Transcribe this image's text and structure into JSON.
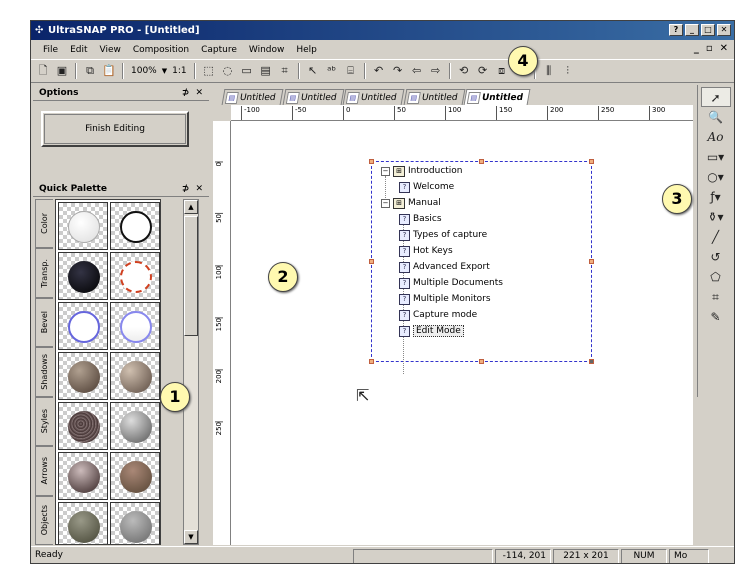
{
  "window": {
    "title": "UltraSNAP PRO - [Untitled]"
  },
  "menubar": {
    "items": [
      "File",
      "Edit",
      "View",
      "Composition",
      "Capture",
      "Window",
      "Help"
    ]
  },
  "toolbar": {
    "zoom": "100%",
    "ratio": "1:1"
  },
  "options_panel": {
    "title": "Options",
    "finish_button": "Finish Editing"
  },
  "quick_palette": {
    "title": "Quick Palette",
    "tabs": [
      "Color",
      "Transp.",
      "Bevel",
      "Shadows",
      "Styles",
      "Arrows",
      "Objects"
    ]
  },
  "doc_tabs": [
    "Untitled",
    "Untitled",
    "Untitled",
    "Untitled",
    "Untitled"
  ],
  "ruler": {
    "top": [
      "-100",
      "-50",
      "0",
      "50",
      "100",
      "150",
      "200",
      "250",
      "300"
    ],
    "left": [
      "0",
      "50",
      "100",
      "150",
      "200",
      "250"
    ]
  },
  "tree": {
    "items": [
      {
        "label": "Introduction",
        "kind": "book"
      },
      {
        "label": "Welcome",
        "kind": "page"
      },
      {
        "label": "Manual",
        "kind": "book"
      },
      {
        "label": "Basics",
        "kind": "page"
      },
      {
        "label": "Types of capture",
        "kind": "page"
      },
      {
        "label": "Hot Keys",
        "kind": "page"
      },
      {
        "label": "Advanced Export",
        "kind": "page"
      },
      {
        "label": "Multiple Documents",
        "kind": "page"
      },
      {
        "label": "Multiple Monitors",
        "kind": "page"
      },
      {
        "label": "Capture mode",
        "kind": "page"
      },
      {
        "label": "Edit Mode",
        "kind": "page"
      }
    ]
  },
  "statusbar": {
    "status": "Ready",
    "coords": "-114, 201",
    "size": "221 x 201",
    "num": "NUM",
    "extra": "Mo"
  },
  "callouts": [
    "1",
    "2",
    "3",
    "4"
  ],
  "colors": {
    "titlebar": "#0a246a",
    "canvas": "#ffffff",
    "selection": "#3333cc",
    "callout": "#fff9b0"
  }
}
